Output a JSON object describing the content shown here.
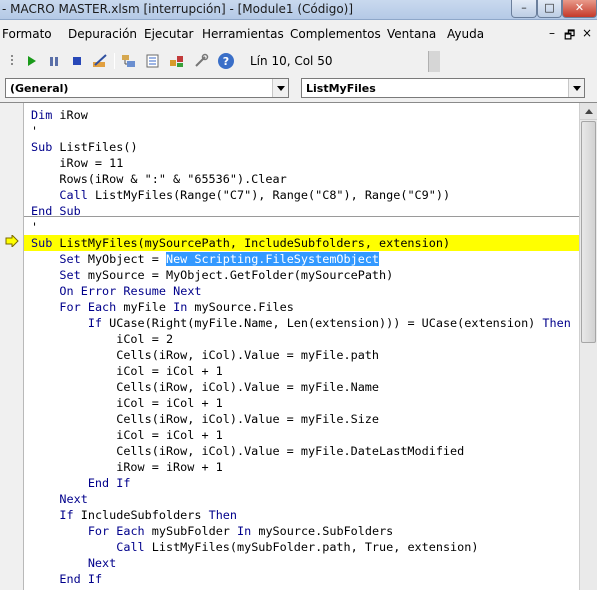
{
  "window": {
    "title": "- MACRO MASTER.xlsm [interrupción] - [Module1 (Código)]",
    "minimize": "–",
    "maximize": "□",
    "close": "✕"
  },
  "menu": {
    "items": [
      "Formato",
      "Depuración",
      "Ejecutar",
      "Herramientas",
      "Complementos",
      "Ventana",
      "Ayuda"
    ],
    "mdi_minimize": "–",
    "mdi_restore": "🗗",
    "mdi_close": "×"
  },
  "toolbar": {
    "position": "Lín 10, Col 50",
    "icons": [
      "run-icon",
      "pause-icon",
      "reset-icon",
      "design-mode-icon",
      "project-explorer-icon",
      "properties-icon",
      "object-browser-icon",
      "toolbox-icon",
      "help-icon"
    ]
  },
  "combos": {
    "object": "(General)",
    "procedure": "ListMyFiles"
  },
  "code": {
    "lines": [
      "Dim iRow",
      "'",
      "Sub ListFiles()",
      "    iRow = 11",
      "    Rows(iRow & \":\" & \"65536\").Clear",
      "    Call ListMyFiles(Range(\"C7\"), Range(\"C8\"), Range(\"C9\"))",
      "End Sub",
      "'",
      "Sub ListMyFiles(mySourcePath, IncludeSubfolders, extension)",
      "    Set MyObject = New Scripting.FileSystemObject",
      "    Set mySource = MyObject.GetFolder(mySourcePath)",
      "    On Error Resume Next",
      "    For Each myFile In mySource.Files",
      "        If UCase(Right(myFile.Name, Len(extension))) = UCase(extension) Then",
      "            iCol = 2",
      "            Cells(iRow, iCol).Value = myFile.path",
      "            iCol = iCol + 1",
      "            Cells(iRow, iCol).Value = myFile.Name",
      "            iCol = iCol + 1",
      "            Cells(iRow, iCol).Value = myFile.Size",
      "            iCol = iCol + 1",
      "            Cells(iRow, iCol).Value = myFile.DateLastModified",
      "            iRow = iRow + 1",
      "        End If",
      "    Next",
      "    If IncludeSubfolders Then",
      "        For Each mySubFolder In mySource.SubFolders",
      "            Call ListMyFiles(mySubFolder.path, True, extension)",
      "        Next",
      "    End If"
    ],
    "current_line": 9,
    "selected_text": "New Scripting.FileSystemObject",
    "keyword_color": "#00008b",
    "highlight_color": "#ffff00",
    "selection_color": "#3399ff"
  }
}
